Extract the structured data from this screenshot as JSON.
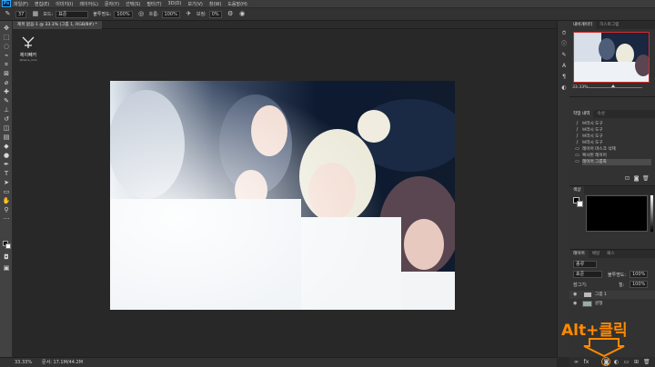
{
  "menu": {
    "logo": "Ps",
    "items": [
      "파일(F)",
      "편집(E)",
      "이미지(I)",
      "레이어(L)",
      "문자(Y)",
      "선택(S)",
      "필터(T)",
      "3D(D)",
      "보기(V)",
      "창(W)",
      "도움말(H)"
    ]
  },
  "options": {
    "brush_size": "37",
    "mode_label": "모드:",
    "mode_value": "표준",
    "opacity_label": "불투명도:",
    "opacity_value": "100%",
    "flow_label": "흐름:",
    "flow_value": "100%",
    "smoothing_label": "보정:",
    "smoothing_value": "0%"
  },
  "document": {
    "tab_title": "제목 없음-1 @ 33.3% (그룹 1, RGB/8#) *",
    "watermark_name": "제이빼카",
    "watermark_handle": "@twice_mini",
    "zoom_status": "33.33%",
    "doc_info": "문서: 17.1M/44.2M"
  },
  "panels": {
    "navigator": {
      "tabs": [
        "내비게이터",
        "히스토그램"
      ],
      "zoom": "33.33%"
    },
    "history": {
      "tabs": [
        "작업 내역",
        "속성"
      ],
      "items": [
        "브러시 도구",
        "브러시 도구",
        "브러시 도구",
        "브러시 도구",
        "레이어 마스크 삭제",
        "복사된 레이어",
        "레이어 그룹화"
      ],
      "selected_index": 6
    },
    "color": {
      "tabs": [
        "색상"
      ],
      "foreground": "#000000",
      "background": "#ffffff"
    },
    "layers": {
      "tabs": [
        "레이어",
        "채널",
        "패스"
      ],
      "kind_label": "종류",
      "blend_mode": "표준",
      "opacity_label": "불투명도:",
      "opacity_value": "100%",
      "fill_label": "칠:",
      "fill_value": "100%",
      "lock_label": "잠그기:",
      "items": [
        {
          "name": "그룹 1",
          "kind": "group"
        },
        {
          "name": "원형",
          "kind": "pixel"
        }
      ]
    }
  },
  "annotation": {
    "callout": "Alt+클릭",
    "color": "#ff8a00"
  }
}
